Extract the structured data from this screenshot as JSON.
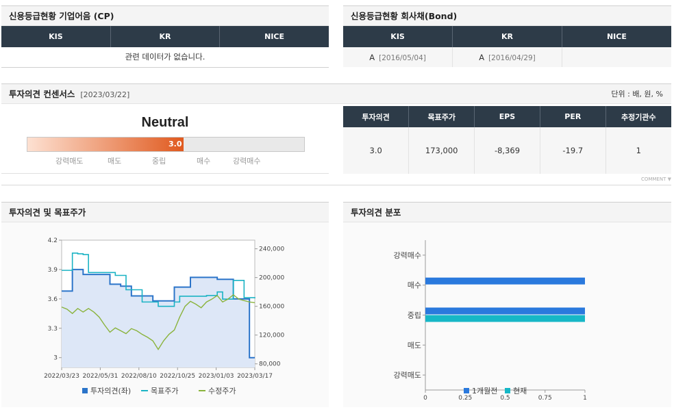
{
  "cp": {
    "title": "신용등급현황 기업어음 (CP)",
    "columns": [
      "KIS",
      "KR",
      "NICE"
    ],
    "empty_text": "관련 데이터가 없습니다."
  },
  "bond": {
    "title": "신용등급현황 회사채(Bond)",
    "columns": [
      "KIS",
      "KR",
      "NICE"
    ],
    "row": [
      {
        "grade": "A",
        "date": "[2016/05/04]"
      },
      {
        "grade": "A",
        "date": "[2016/04/29]"
      },
      {
        "grade": "",
        "date": ""
      }
    ]
  },
  "consensus": {
    "title": "투자의견 컨센서스",
    "date": "[2023/03/22]",
    "unit": "단위 : 배, 원, %",
    "opinion": "Neutral",
    "score": "3.0",
    "score_value": 3.0,
    "scale_labels": [
      "강력매도",
      "매도",
      "중립",
      "매수",
      "강력매수"
    ],
    "columns": [
      "투자의견",
      "목표주가",
      "EPS",
      "PER",
      "추정기관수"
    ],
    "values": [
      "3.0",
      "173,000",
      "-8,369",
      "-19.7",
      "1"
    ],
    "comment": "COMMENT"
  },
  "chart1": {
    "title": "투자의견 및 목표주가",
    "legend": [
      "투자의견(좌)",
      "목표주가",
      "수정주가"
    ]
  },
  "chart2": {
    "title": "투자의견 분포",
    "legend": [
      "1개월전",
      "현재"
    ]
  },
  "colors": {
    "opinion": "#2b74c9",
    "target": "#1ab3c4",
    "price": "#8ab33c",
    "area": "#dde7f7",
    "bar_prev": "#2a79dd",
    "bar_now": "#16b7c6",
    "header": "#2d3b48",
    "gauge": "#e05a1f"
  },
  "chart_data": [
    {
      "type": "line",
      "x_ticks": [
        "2022/03/23",
        "2022/05/31",
        "2022/08/10",
        "2022/10/25",
        "2023/01/03",
        "2023/03/17"
      ],
      "y_left_ticks": [
        "4.2",
        "3.9",
        "3.6",
        "3.3",
        "3"
      ],
      "y_left_range": [
        2.9,
        4.2
      ],
      "y_right_ticks": [
        "240,000",
        "200,000",
        "160,000",
        "120,000",
        "80,000"
      ],
      "y_right_range": [
        75000,
        252000
      ],
      "series": [
        {
          "name": "투자의견(좌)",
          "axis": "left",
          "values": [
            3.68,
            3.68,
            3.9,
            3.9,
            3.85,
            3.85,
            3.85,
            3.85,
            3.85,
            3.75,
            3.75,
            3.73,
            3.73,
            3.63,
            3.63,
            3.63,
            3.63,
            3.58,
            3.58,
            3.58,
            3.58,
            3.72,
            3.72,
            3.72,
            3.82,
            3.82,
            3.82,
            3.82,
            3.82,
            3.8,
            3.8,
            3.8,
            3.6,
            3.6,
            3.6,
            3.0,
            3.0
          ]
        },
        {
          "name": "목표주가",
          "axis": "right",
          "values": [
            210000,
            210000,
            234000,
            233000,
            232000,
            207000,
            207000,
            207000,
            207000,
            207000,
            203000,
            203000,
            183000,
            183000,
            183000,
            166000,
            166000,
            166000,
            160000,
            160000,
            160000,
            166000,
            174000,
            174000,
            174000,
            174000,
            174000,
            175000,
            175000,
            180000,
            170000,
            170000,
            196000,
            196000,
            172000,
            172000,
            171000
          ]
        },
        {
          "name": "수정주가",
          "axis": "right",
          "values": [
            159000,
            156000,
            150000,
            157000,
            152000,
            157000,
            152000,
            145000,
            134000,
            124000,
            130000,
            126000,
            122000,
            129000,
            126000,
            121000,
            117000,
            112000,
            100000,
            112000,
            121000,
            127000,
            145000,
            160000,
            167000,
            163000,
            158000,
            166000,
            170000,
            175000,
            166000,
            170000,
            176000,
            170000,
            168000,
            166000,
            165000
          ]
        }
      ]
    },
    {
      "type": "bar",
      "orientation": "horizontal",
      "categories": [
        "강력매수",
        "매수",
        "중립",
        "매도",
        "강력매도"
      ],
      "x_ticks": [
        "0",
        "0.25",
        "0.5",
        "0.75",
        "1"
      ],
      "xlim": [
        0,
        1
      ],
      "series": [
        {
          "name": "1개월전",
          "values": [
            0,
            1,
            1,
            0,
            0
          ]
        },
        {
          "name": "현재",
          "values": [
            0,
            0,
            1,
            0,
            0
          ]
        }
      ]
    }
  ]
}
